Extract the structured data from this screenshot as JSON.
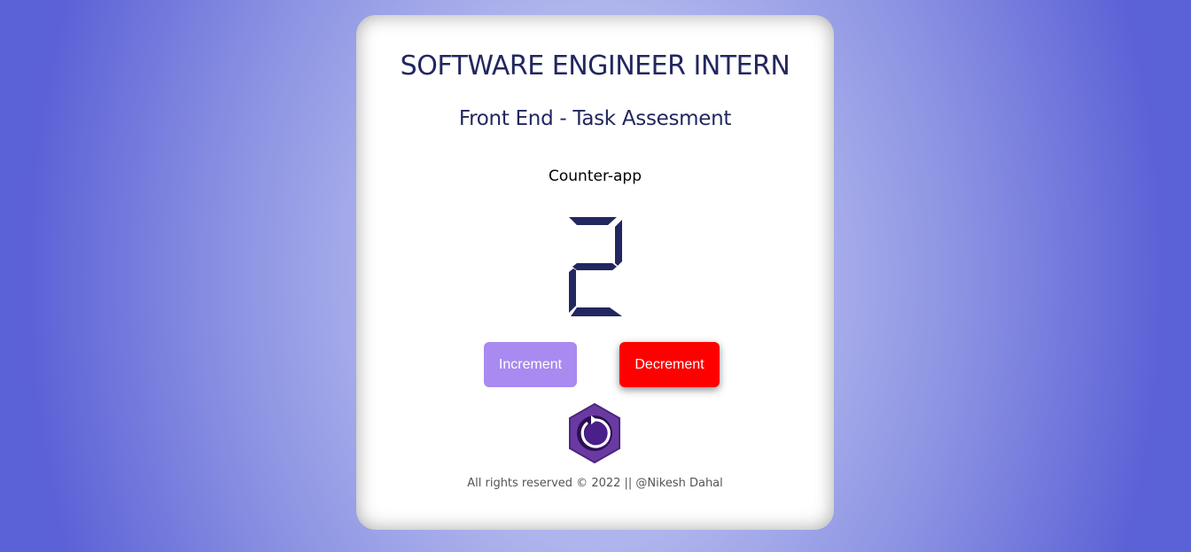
{
  "header": {
    "title": "SOFTWARE ENGINEER INTERN",
    "subtitle": "Front End - Task Assesment",
    "app_name": "Counter-app"
  },
  "counter": {
    "value": "2",
    "digit_color": "#22275f"
  },
  "buttons": {
    "increment_label": "Increment",
    "decrement_label": "Decrement",
    "increment_color": "#a88af0",
    "decrement_color": "#ff0000"
  },
  "reset": {
    "icon": "reset-icon",
    "color": "#5a2d8c"
  },
  "footer": {
    "text": "All rights reserved © 2022 || @Nikesh Dahal"
  }
}
